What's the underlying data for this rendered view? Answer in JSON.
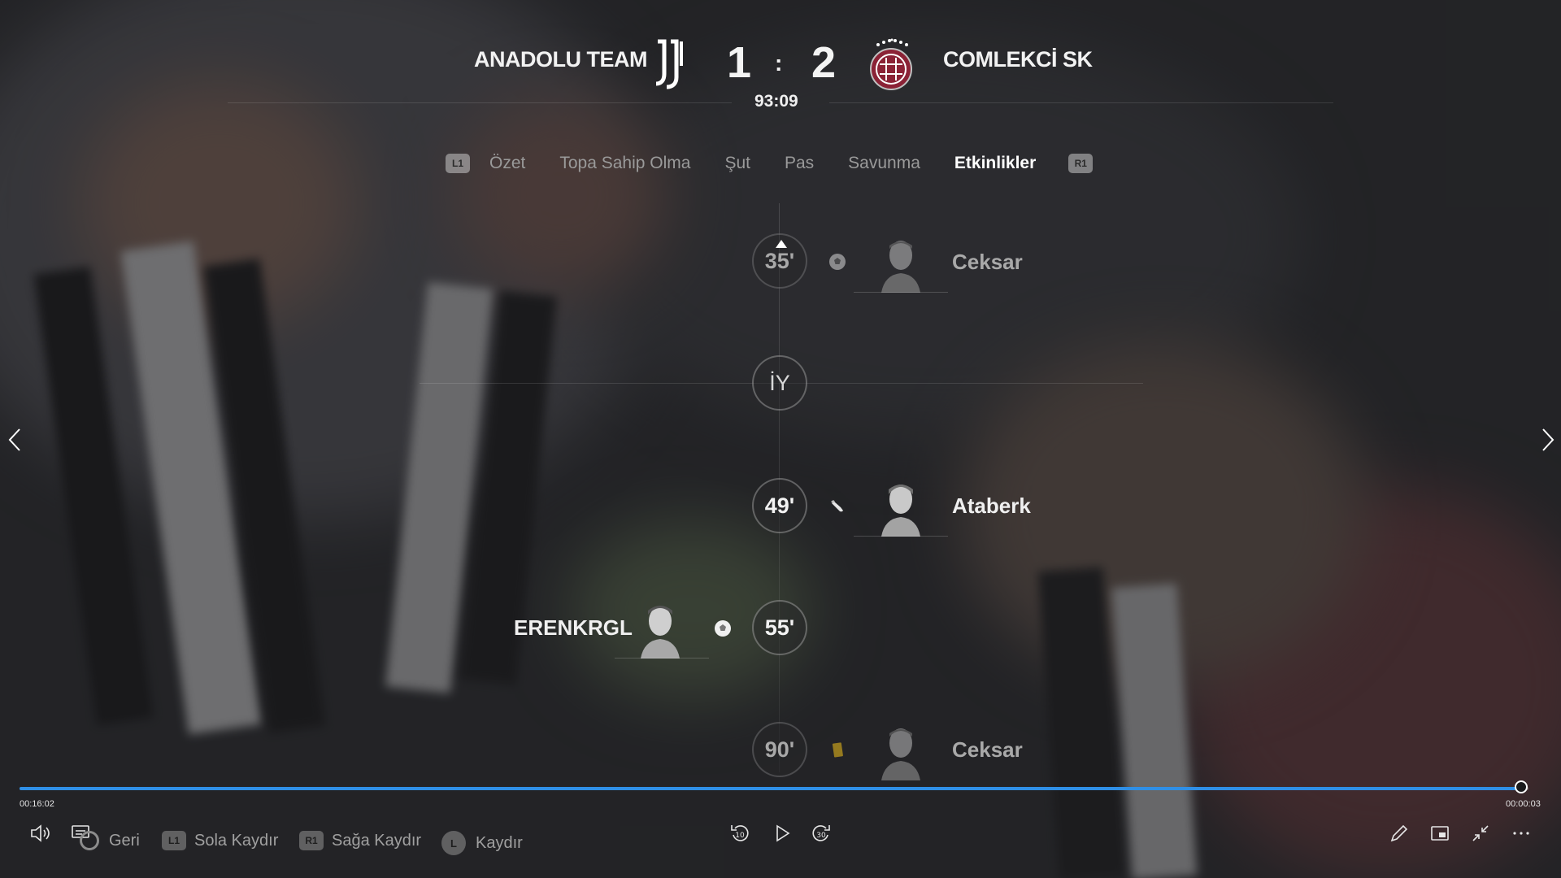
{
  "scoreboard": {
    "home_team": "ANADOLU TEAM",
    "away_team": "COMLEKCİ SK",
    "home_score": "1",
    "separator": ":",
    "away_score": "2",
    "match_clock": "93:09",
    "home_crest": "juventus-crest-icon",
    "away_crest": "lanus-crest-icon",
    "away_crest_color": "#8b2236"
  },
  "tabs": {
    "left_button": "L1",
    "right_button": "R1",
    "items": [
      {
        "label": "Özet",
        "active": false
      },
      {
        "label": "Topa Sahip Olma",
        "active": false
      },
      {
        "label": "Şut",
        "active": false
      },
      {
        "label": "Pas",
        "active": false
      },
      {
        "label": "Savunma",
        "active": false
      },
      {
        "label": "Etkinlikler",
        "active": true
      }
    ]
  },
  "timeline": {
    "events": [
      {
        "minute": "35'",
        "icon": "ball-icon",
        "player": "Ceksar",
        "side": "away",
        "faded": true
      },
      {
        "minute": "İY",
        "icon": "",
        "player": "",
        "side": "center",
        "faded": false
      },
      {
        "minute": "49'",
        "icon": "assist-boot-icon",
        "player": "Ataberk",
        "side": "away",
        "faded": false
      },
      {
        "minute": "55'",
        "icon": "ball-icon",
        "player": "ERENKRGL",
        "side": "home",
        "faded": false
      },
      {
        "minute": "90'",
        "icon": "yellow-card-icon",
        "player": "Ceksar",
        "side": "away",
        "faded": true
      }
    ]
  },
  "player": {
    "elapsed": "00:16:02",
    "remaining": "00:00:03",
    "progress": 0.995,
    "accent": "#2f8fe6",
    "hints": [
      {
        "button": "circle",
        "label": "Geri"
      },
      {
        "button": "L1",
        "label": "Sola Kaydır"
      },
      {
        "button": "R1",
        "label": "Sağa Kaydır"
      },
      {
        "button": "L",
        "label": "Kaydır"
      }
    ],
    "rewind_seconds": "10",
    "forward_seconds": "30"
  }
}
